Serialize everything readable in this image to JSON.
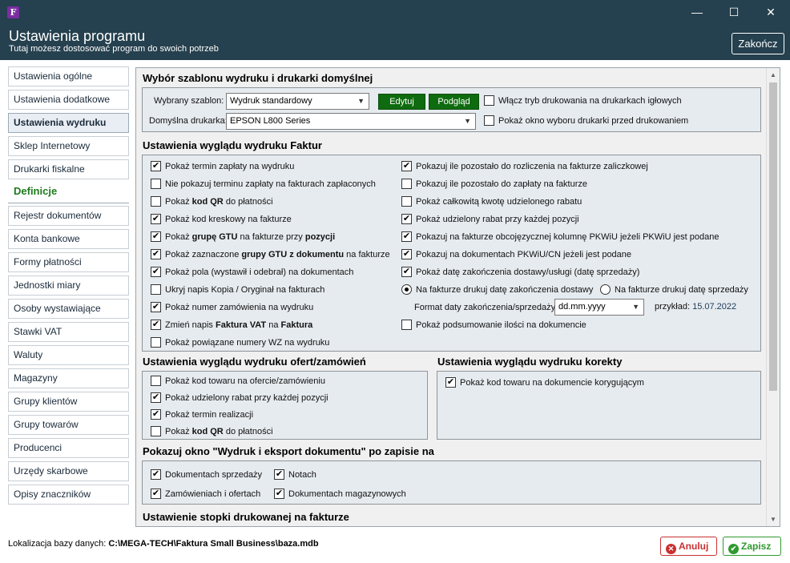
{
  "window": {
    "app_icon": "F",
    "minimize": "—",
    "maximize": "☐",
    "close": "✕"
  },
  "header": {
    "title": "Ustawienia programu",
    "subtitle": "Tutaj możesz dostosować program do swoich potrzeb",
    "close_button": "Zakończ"
  },
  "sidebar": {
    "items": [
      {
        "label": "Ustawienia ogólne"
      },
      {
        "label": "Ustawienia dodatkowe"
      },
      {
        "label": "Ustawienia wydruku",
        "active": true
      },
      {
        "label": "Sklep Internetowy"
      },
      {
        "label": "Drukarki fiskalne"
      }
    ],
    "definitions_heading": "Definicje",
    "definitions": [
      {
        "label": "Rejestr dokumentów"
      },
      {
        "label": "Konta bankowe"
      },
      {
        "label": "Formy płatności"
      },
      {
        "label": "Jednostki miary"
      },
      {
        "label": "Osoby wystawiające"
      },
      {
        "label": "Stawki VAT"
      },
      {
        "label": "Waluty"
      },
      {
        "label": "Magazyny"
      },
      {
        "label": "Grupy klientów"
      },
      {
        "label": "Grupy towarów"
      },
      {
        "label": "Producenci"
      },
      {
        "label": "Urzędy skarbowe"
      },
      {
        "label": "Opisy znaczników"
      }
    ]
  },
  "template_section": {
    "title": "Wybór szablonu wydruku i drukarki domyślnej",
    "template_label": "Wybrany szablon:",
    "template_value": "Wydruk standardowy",
    "edit_button": "Edytuj",
    "preview_button": "Podgląd",
    "printer_label": "Domyślna drukarka:",
    "printer_value": "EPSON L800 Series",
    "dot_matrix": {
      "label": "Włącz tryb drukowania na drukarkach igłowych",
      "checked": false
    },
    "printer_dialog": {
      "label": "Pokaż okno wyboru drukarki przed drukowaniem",
      "checked": false
    }
  },
  "invoice_section": {
    "title": "Ustawienia wyglądu wydruku Faktur",
    "left": [
      {
        "pre": "Pokaż termin zapłaty na wydruku",
        "checked": true
      },
      {
        "pre": "Nie pokazuj terminu zapłaty na fakturach zapłaconych",
        "checked": false
      },
      {
        "pre": "Pokaż ",
        "bold": "kod QR",
        "post": " do płatności",
        "checked": false
      },
      {
        "pre": "Pokaż kod kreskowy na fakturze",
        "checked": true
      },
      {
        "pre": "Pokaż ",
        "bold": "grupę GTU",
        "post": " na fakturze przy ",
        "bold2": "pozycji",
        "checked": true
      },
      {
        "pre": "Pokaż zaznaczone ",
        "bold": "grupy GTU z dokumentu",
        "post": " na fakturze",
        "checked": true
      },
      {
        "pre": "Pokaż pola (wystawił i odebrał) na dokumentach",
        "checked": true
      },
      {
        "pre": "Ukryj napis Kopia / Oryginał na fakturach",
        "checked": false
      },
      {
        "pre": "Pokaż numer zamówienia na wydruku",
        "checked": true
      },
      {
        "pre": "Zmień napis ",
        "bold": "Faktura VAT",
        "post": " na ",
        "bold2": "Faktura",
        "checked": true
      },
      {
        "pre": "Pokaż powiązane numery WZ na wydruku",
        "checked": false
      }
    ],
    "right": [
      {
        "pre": "Pokazuj ile pozostało do rozliczenia na fakturze zaliczkowej",
        "checked": true
      },
      {
        "pre": "Pokazuj ile pozostało do zapłaty na fakturze",
        "checked": false
      },
      {
        "pre": "Pokaż całkowitą kwotę udzielonego rabatu",
        "checked": false
      },
      {
        "pre": "Pokaż udzielony rabat przy każdej pozycji",
        "checked": true
      },
      {
        "pre": "Pokazuj na fakturze obcojęzycznej kolumnę PKWiU jeżeli PKWiU jest podane",
        "checked": true
      },
      {
        "pre": "Pokazuj na dokumentach PKWiU/CN jeżeli jest podane",
        "checked": true
      },
      {
        "pre": "Pokaż datę zakończenia dostawy/usługi (datę sprzedaży)",
        "checked": true
      }
    ],
    "radio_delivery": {
      "label": "Na fakturze drukuj datę zakończenia dostawy",
      "selected": true
    },
    "radio_sale": {
      "label": "Na fakturze drukuj datę sprzedaży",
      "selected": false
    },
    "date_format_label": "Format daty zakończenia/sprzedaży",
    "date_format_value": "dd.mm.yyyy",
    "example_label": "przykład:",
    "example_value": "15.07.2022",
    "quantity_summary": {
      "pre": "Pokaż podsumowanie ilości na dokumencie",
      "checked": false
    }
  },
  "offers_section": {
    "title": "Ustawienia wyglądu wydruku ofert/zamówień",
    "items": [
      {
        "pre": "Pokaż kod towaru na ofercie/zamówieniu",
        "checked": false
      },
      {
        "pre": "Pokaż udzielony rabat przy każdej pozycji",
        "checked": true
      },
      {
        "pre": "Pokaż termin realizacji",
        "checked": true
      },
      {
        "pre": "Pokaż ",
        "bold": "kod QR",
        "post": " do płatności",
        "checked": false
      }
    ]
  },
  "corrections_section": {
    "title": "Ustawienia wyglądu wydruku korekty",
    "items": [
      {
        "pre": "Pokaż kod towaru na dokumencie korygującym",
        "checked": true
      }
    ]
  },
  "export_section": {
    "title": "Pokazuj okno \"Wydruk i eksport dokumentu\" po zapisie na",
    "items": [
      {
        "pre": "Dokumentach sprzedaży",
        "checked": true
      },
      {
        "pre": "Notach",
        "checked": true
      },
      {
        "pre": "Zamówieniach i ofertach",
        "checked": true
      },
      {
        "pre": "Dokumentach magazynowych",
        "checked": true
      }
    ]
  },
  "footer_section": {
    "title": "Ustawienie stopki drukowanej na fakturze"
  },
  "footer": {
    "db_label": "Lokalizacja bazy danych:",
    "db_path": "C:\\MEGA-TECH\\Faktura Small Business\\baza.mdb",
    "cancel_button": "Anuluj",
    "save_button": "Zapisz"
  }
}
